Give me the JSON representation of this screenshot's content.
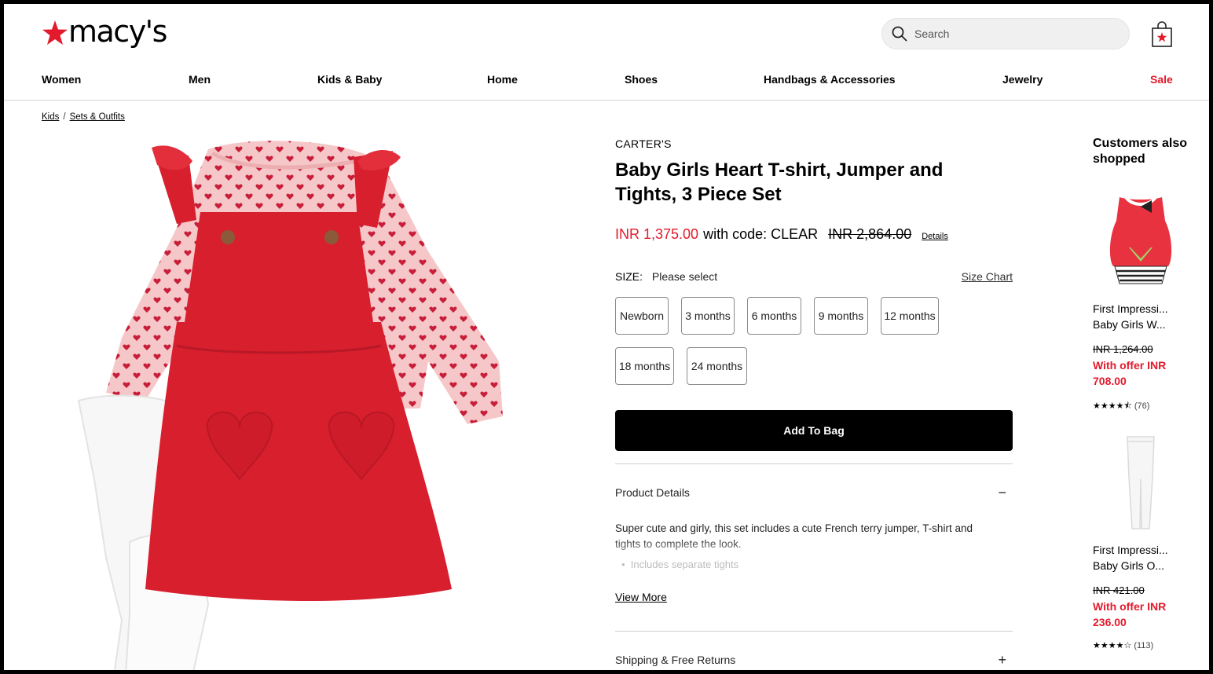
{
  "brand": {
    "name": "macy's",
    "accent": "#e21a2c"
  },
  "search": {
    "placeholder": "Search"
  },
  "nav": {
    "items": [
      "Women",
      "Men",
      "Kids & Baby",
      "Home",
      "Shoes",
      "Handbags & Accessories",
      "Jewelry",
      "Sale"
    ]
  },
  "breadcrumb": {
    "items": [
      "Kids",
      "Sets & Outfits"
    ],
    "separator": "/"
  },
  "product": {
    "brand": "CARTER'S",
    "title": "Baby Girls Heart T-shirt, Jumper and Tights, 3 Piece Set",
    "sale_price": "INR 1,375.00",
    "code_text": "with code: CLEAR",
    "original_price": "INR 2,864.00",
    "details_link": "Details",
    "size_label": "SIZE:",
    "size_selected": "Please select",
    "size_chart": "Size Chart",
    "sizes": [
      "Newborn",
      "3 months",
      "6 months",
      "9 months",
      "12 months",
      "18 months",
      "24 months"
    ],
    "add_to_bag": "Add To Bag",
    "product_details_heading": "Product Details",
    "description": "Super cute and girly, this set includes a cute French terry jumper, T-shirt and tights to complete the look.",
    "bullet": "Includes separate tights",
    "view_more": "View More",
    "shipping_heading": "Shipping & Free Returns",
    "collapse_symbol": "−",
    "expand_symbol": "+"
  },
  "rail": {
    "title": "Customers also shopped",
    "items": [
      {
        "brand": "First Impressi...",
        "name": "Baby Girls W...",
        "was": "INR 1,264.00",
        "offer": "With offer INR 708.00",
        "stars": "★★★★⯪",
        "rating": 4.5,
        "count": "(76)"
      },
      {
        "brand": "First Impressi...",
        "name": "Baby Girls O...",
        "was": "INR 421.00",
        "offer": "With offer INR 236.00",
        "stars": "★★★★☆",
        "rating": 4,
        "count": "(113)"
      }
    ]
  }
}
